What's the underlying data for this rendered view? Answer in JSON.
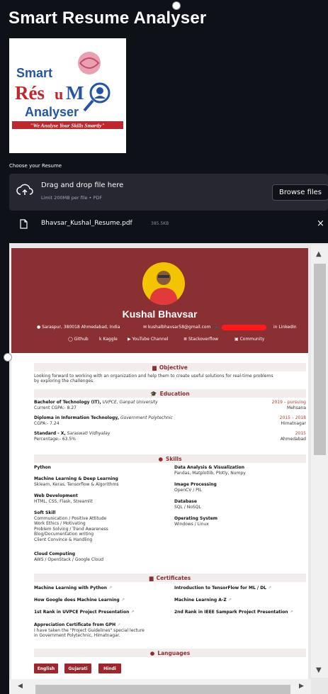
{
  "app": {
    "title": "Smart Resume Analyser"
  },
  "logo": {
    "line1": "Smart",
    "line2a": "Rés",
    "line2b": "u",
    "line2c": "M",
    "line3": "Analyser",
    "tagline": "\"We Analyse Your Skills Smartly\""
  },
  "uploader": {
    "label": "Choose your Resume",
    "drag_text": "Drag and drop file here",
    "limit_text": "Limit 200MB per file • PDF",
    "browse_label": "Browse files",
    "icon": "cloud-upload-icon"
  },
  "file": {
    "name": "Bhavsar_Kushal_Resume.pdf",
    "size": "385.5KB",
    "close": "×",
    "icon": "file-icon"
  },
  "resume": {
    "name": "Kushal Bhavsar",
    "address": "Saraspur, 380018 Ahmedabad, India",
    "email": "kushalbhavsar58@gmail.com",
    "linkedin": "LinkedIn",
    "links": [
      "Github",
      "Kaggle",
      "YouTube Channel",
      "Stackoverflow",
      "Community"
    ],
    "sections": {
      "objective": "Objective",
      "education": "Education",
      "skills": "Skills",
      "certificates": "Certificates",
      "languages": "Languages"
    },
    "objective_text": [
      "Looking forward to working with an organization and help them to create useful solutions for real-time problems",
      "by exploring the challenges."
    ],
    "education": [
      {
        "degree": "Bachelor of Technology (IT),",
        "school": "UVPCE, Ganpat University",
        "detail": "Current CGPA:- 8.27",
        "date": "2019 – pursuing",
        "place": "Mehsana"
      },
      {
        "degree": "Diploma in Information Technology,",
        "school": "Government Polytechnic",
        "detail": "CGPA:- 7.24",
        "date": "2015 – 2018",
        "place": "Himatnagar"
      },
      {
        "degree": "Standard - X,",
        "school": "Saraswati Vidhyalay",
        "detail": "Percentage:- 63.5%",
        "date": "2015",
        "place": "Ahmedabad"
      }
    ],
    "skills_left": [
      {
        "title": "Python",
        "lines": []
      },
      {
        "title": "Machine Learning & Deep Learning",
        "lines": [
          "Sklearn, Keras, Tensorflow & Algorithms"
        ]
      },
      {
        "title": "Web Development",
        "lines": [
          "HTML, CSS, Flask, Streamlit"
        ]
      },
      {
        "title": "Soft Skill",
        "lines": [
          "Communication / Positive Attitude",
          "Work Ethics / Motivating",
          "Problem Solving / Trend Awareness",
          "Blog/Documentation writing",
          "Client Convince & Handling"
        ]
      },
      {
        "title": "Cloud Computing",
        "lines": [
          "AWS / OpenStack / Google Cloud"
        ]
      }
    ],
    "skills_right": [
      {
        "title": "Data Analysis & Visualization",
        "lines": [
          "Pandas, Matplotlib, Plotly, Numpy"
        ]
      },
      {
        "title": "Image Processing",
        "lines": [
          "OpenCV / PIL"
        ]
      },
      {
        "title": "Database",
        "lines": [
          "SQL / NoSQL"
        ]
      },
      {
        "title": "Operating System",
        "lines": [
          "Windows / Linux"
        ]
      }
    ],
    "certificates": [
      {
        "title": "Machine Learning with Python",
        "col": 0
      },
      {
        "title": "Introduction to TensorFlow for ML / DL",
        "col": 1
      },
      {
        "title": "How Google does Machine Learning",
        "col": 0
      },
      {
        "title": "Machine Learning A-Z",
        "col": 1
      },
      {
        "title": "1st Rank in UVPCE Project Presentation",
        "col": 0
      },
      {
        "title": "2nd Rank in IEEE Sampark Project Presentation",
        "col": 1
      }
    ],
    "cert_gph": {
      "title": "Appreciation Certificate from GPH",
      "lines": [
        "I have taken the \"Project Guidelines\" special lecture",
        "in Government Polytechnic, Himatnagar."
      ]
    },
    "languages": [
      "English",
      "Gujarati",
      "Hindi"
    ]
  },
  "colors": {
    "app_bg": "#0e1117",
    "banner": "#8a3032",
    "accent": "#a0262b",
    "section_bg": "#f3ecec",
    "avatar_bg": "#f4c400",
    "redaction": "#ff1a1a"
  }
}
